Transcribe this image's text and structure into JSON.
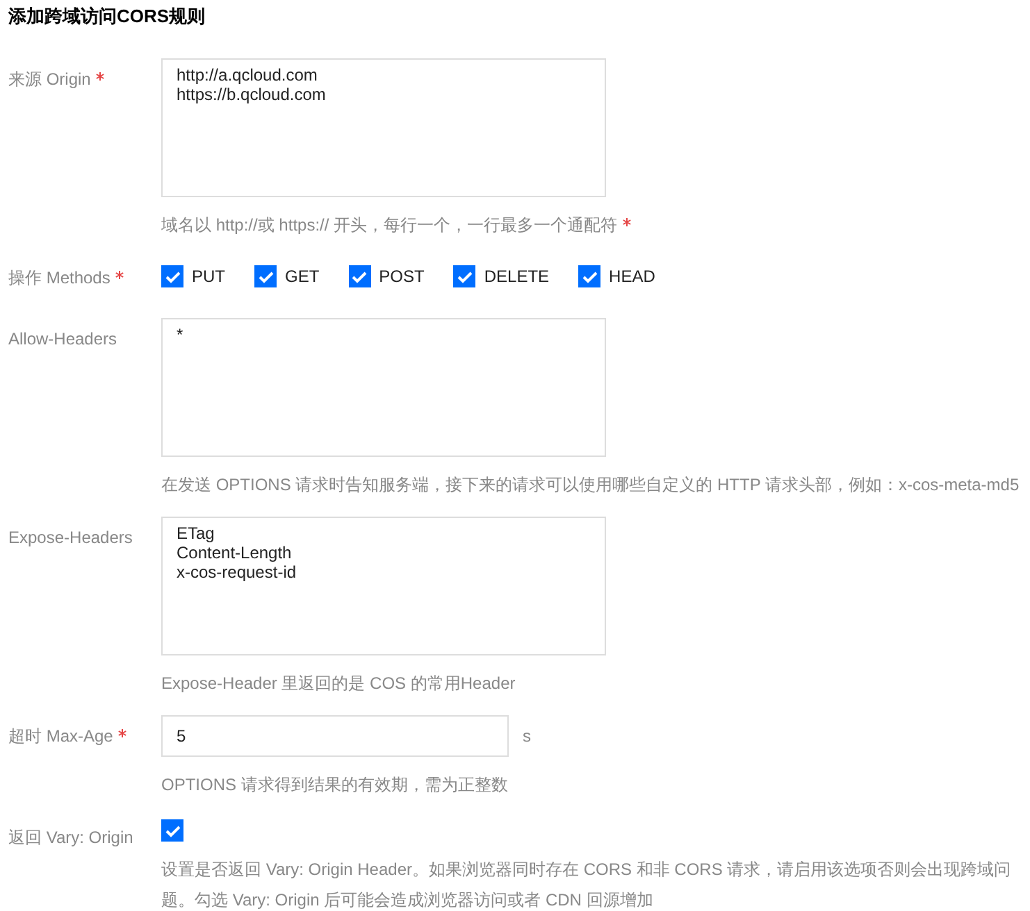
{
  "title": "添加跨域访问CORS规则",
  "fields": [
    {
      "kind": "textarea",
      "label": "来源 Origin",
      "required": true,
      "value": "http://a.qcloud.com\nhttps://b.qcloud.com",
      "hint": "域名以 http://或 https:// 开头，每行一个，一行最多一个通配符",
      "hint_required": true
    },
    {
      "kind": "checkboxes",
      "label": "操作 Methods",
      "required": true,
      "options": [
        {
          "label": "PUT",
          "checked": true
        },
        {
          "label": "GET",
          "checked": true
        },
        {
          "label": "POST",
          "checked": true
        },
        {
          "label": "DELETE",
          "checked": true
        },
        {
          "label": "HEAD",
          "checked": true
        }
      ]
    },
    {
      "kind": "textarea",
      "label": "Allow-Headers",
      "required": false,
      "value": "*",
      "hint": "在发送 OPTIONS 请求时告知服务端，接下来的请求可以使用哪些自定义的 HTTP 请求头部，例如：x-cos-meta-md5",
      "hint_required": false
    },
    {
      "kind": "textarea",
      "label": "Expose-Headers",
      "required": false,
      "value": "ETag\nContent-Length\nx-cos-request-id",
      "hint": "Expose-Header 里返回的是 COS 的常用Header",
      "hint_required": false
    },
    {
      "kind": "input",
      "label": "超时 Max-Age",
      "required": true,
      "value": "5",
      "unit": "s",
      "hint": "OPTIONS 请求得到结果的有效期，需为正整数",
      "hint_required": false
    },
    {
      "kind": "checkbox",
      "label": "返回 Vary: Origin",
      "required": false,
      "checked": true,
      "hint": "设置是否返回 Vary: Origin Header。如果浏览器同时存在 CORS 和非 CORS 请求，请启用该选项否则会出现跨域问题。勾选 Vary: Origin 后可能会造成浏览器访问或者 CDN 回源增加",
      "hint_required": false
    }
  ]
}
